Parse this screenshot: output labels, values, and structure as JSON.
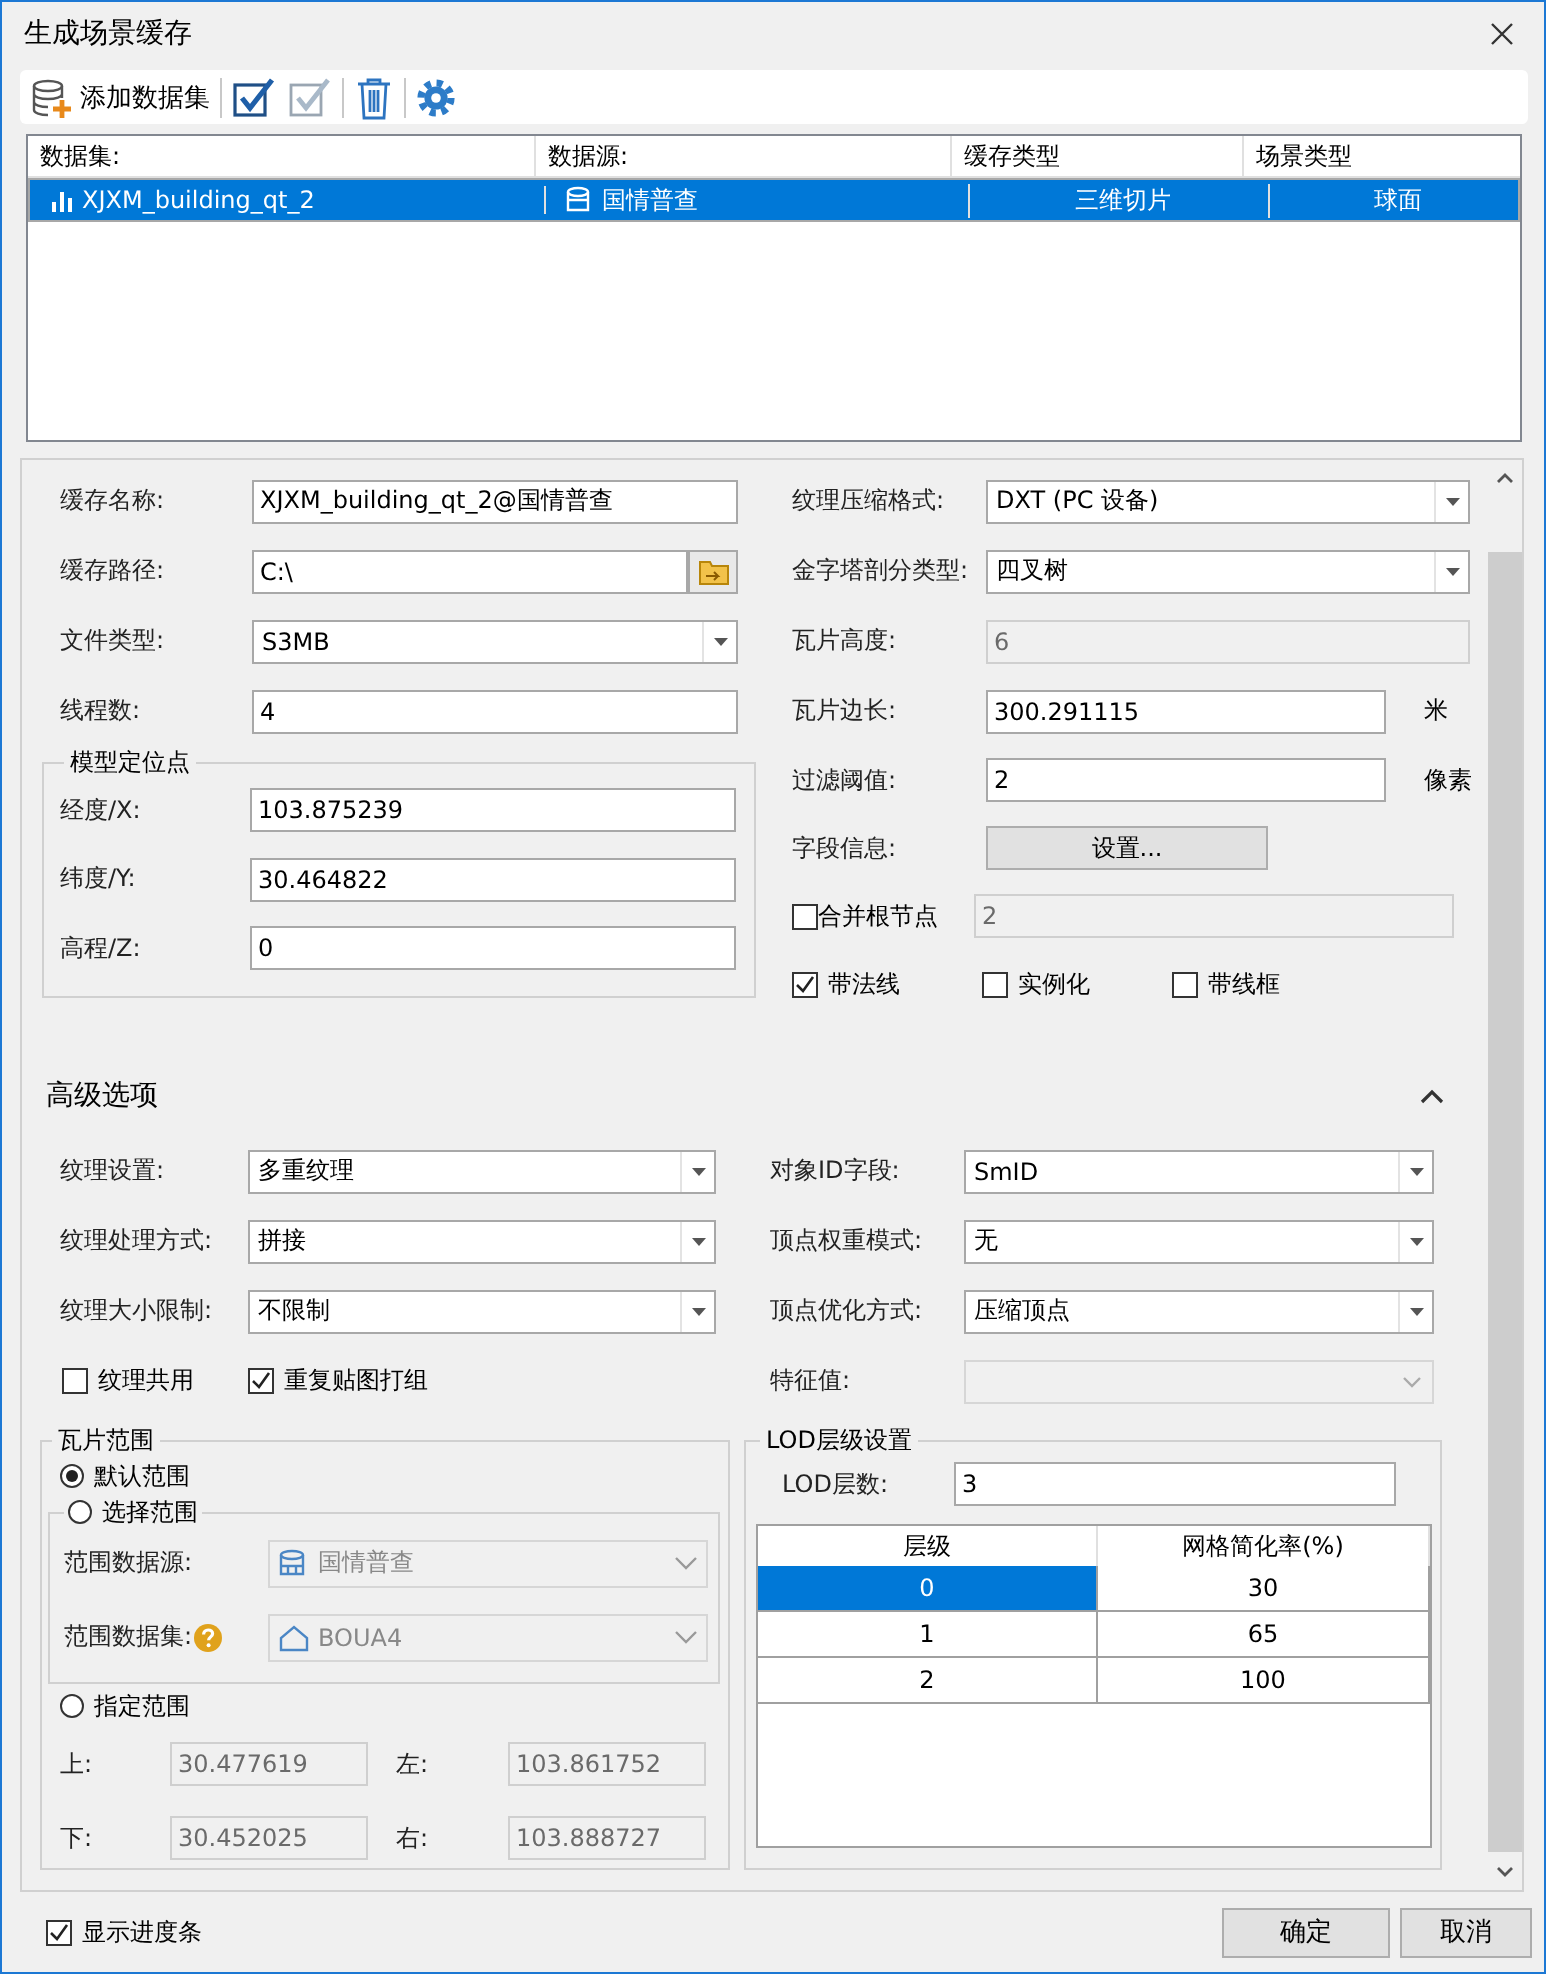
{
  "window": {
    "title": "生成场景缓存"
  },
  "toolbar": {
    "groups": [
      [
        {
          "kind": "add",
          "label": "添加数据集"
        }
      ],
      [
        {
          "kind": "select_all"
        },
        {
          "kind": "select_invert"
        }
      ],
      [
        {
          "kind": "delete"
        }
      ],
      [
        {
          "kind": "settings"
        }
      ]
    ]
  },
  "dataset_table": {
    "columns": [
      "数据集:",
      "数据源:",
      "缓存类型",
      "场景类型"
    ],
    "rows": [
      {
        "selected": true,
        "cells": [
          {
            "text": "XJXM_building_qt_2"
          },
          {
            "text": "国情普查"
          },
          {
            "text": "三维切片"
          },
          {
            "text": "球面"
          }
        ]
      }
    ]
  },
  "cache": {
    "left": [
      {
        "kind": "text",
        "label": "缓存名称:",
        "value": "XJXM_building_qt_2@国情普查",
        "disabled": false
      },
      {
        "kind": "path",
        "label": "缓存路径:",
        "value": "C:\\",
        "disabled": false
      },
      {
        "kind": "select",
        "label": "文件类型:",
        "value": "S3MB",
        "disabled": false
      },
      {
        "kind": "text",
        "label": "线程数:",
        "value": "4",
        "disabled": false
      }
    ],
    "anchor": {
      "title": "模型定位点",
      "fields": [
        {
          "label": "经度/X:",
          "value": "103.875239"
        },
        {
          "label": "纬度/Y:",
          "value": "30.464822"
        },
        {
          "label": "高程/Z:",
          "value": "0"
        }
      ]
    },
    "right": [
      {
        "kind": "select",
        "label": "纹理压缩格式:",
        "value": "DXT (PC 设备)",
        "disabled": false
      },
      {
        "kind": "select",
        "label": "金字塔剖分类型:",
        "value": "四叉树",
        "disabled": false
      },
      {
        "kind": "text",
        "label": "瓦片高度:",
        "value": "6",
        "disabled": true
      },
      {
        "kind": "text",
        "label": "瓦片边长:",
        "value": "300.291115",
        "unit": "米",
        "disabled": false
      },
      {
        "kind": "text",
        "label": "过滤阈值:",
        "value": "2",
        "unit": "像素",
        "disabled": false
      },
      {
        "kind": "button",
        "label": "字段信息:",
        "button": "设置..."
      },
      {
        "kind": "check_text",
        "label": "合并根节点",
        "checked": false,
        "value": "2",
        "disabled": true
      },
      {
        "kind": "checks",
        "items": [
          {
            "label": "带法线",
            "checked": true
          },
          {
            "label": "实例化",
            "checked": false
          },
          {
            "label": "带线框",
            "checked": false
          }
        ]
      }
    ]
  },
  "advanced": {
    "title": "高级选项",
    "expanded": true,
    "left": [
      {
        "label": "纹理设置:",
        "value": "多重纹理",
        "disabled": false
      },
      {
        "label": "纹理处理方式:",
        "value": "拼接",
        "disabled": false
      },
      {
        "label": "纹理大小限制:",
        "value": "不限制",
        "disabled": false
      }
    ],
    "right": [
      {
        "label": "对象ID字段:",
        "value": "SmID",
        "disabled": false
      },
      {
        "label": "顶点权重模式:",
        "value": "无",
        "disabled": false
      },
      {
        "label": "顶点优化方式:",
        "value": "压缩顶点",
        "disabled": false
      }
    ],
    "checks": [
      {
        "label": "纹理共用",
        "checked": false
      },
      {
        "label": "重复贴图打组",
        "checked": true
      }
    ],
    "feature": {
      "label": "特征值:",
      "disabled": true
    }
  },
  "tile_range": {
    "title": "瓦片范围",
    "modes": [
      {
        "label": "默认范围",
        "selected": true
      },
      {
        "label": "选择范围",
        "selected": false
      },
      {
        "label": "指定范围",
        "selected": false
      }
    ],
    "selection": [
      {
        "label": "范围数据源:",
        "value": "国情普查",
        "disabled": true
      },
      {
        "label": "范围数据集:",
        "value": "BOUA4",
        "disabled": true
      }
    ],
    "bounds": [
      {
        "label": "上:",
        "value": "30.477619",
        "disabled": true
      },
      {
        "label": "左:",
        "value": "103.861752",
        "disabled": true
      },
      {
        "label": "下:",
        "value": "30.452025",
        "disabled": true
      },
      {
        "label": "右:",
        "value": "103.888727",
        "disabled": true
      }
    ]
  },
  "lod": {
    "title": "LOD层级设置",
    "count_label": "LOD层数:",
    "count": "3",
    "columns": [
      "层级",
      "网格简化率(%)"
    ],
    "rows": [
      {
        "selected": true,
        "cells": [
          "0",
          "30"
        ]
      },
      {
        "selected": false,
        "cells": [
          "1",
          "65"
        ]
      },
      {
        "selected": false,
        "cells": [
          "2",
          "100"
        ]
      }
    ]
  },
  "footer": {
    "show_progress": {
      "label": "显示进度条",
      "checked": true
    },
    "buttons": [
      "确定",
      "取消"
    ]
  }
}
